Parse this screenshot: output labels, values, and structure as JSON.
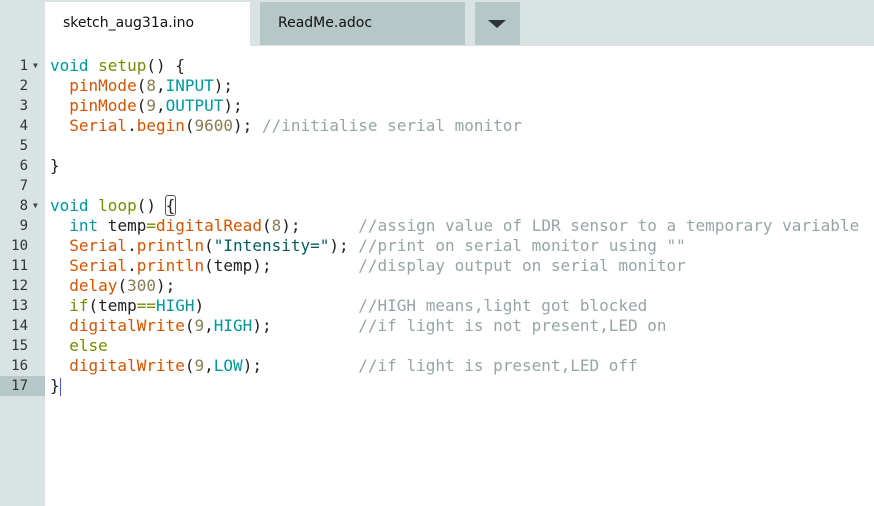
{
  "tabs": [
    {
      "label": "sketch_aug31a.ino",
      "active": true
    },
    {
      "label": "ReadMe.adoc",
      "active": false
    }
  ],
  "tab_menu_icon": "triangle-down-icon",
  "current_line": 17,
  "lines": [
    {
      "n": "1",
      "fold": true,
      "tokens": [
        [
          "kw",
          "void"
        ],
        [
          "pl",
          " "
        ],
        [
          "ctl",
          "setup"
        ],
        [
          "pl",
          "() {"
        ]
      ]
    },
    {
      "n": "2",
      "tokens": [
        [
          "pl",
          "  "
        ],
        [
          "fn",
          "pinMode"
        ],
        [
          "pl",
          "("
        ],
        [
          "num",
          "8"
        ],
        [
          "pl",
          ","
        ],
        [
          "cst",
          "INPUT"
        ],
        [
          "pl",
          ");"
        ]
      ]
    },
    {
      "n": "3",
      "tokens": [
        [
          "pl",
          "  "
        ],
        [
          "fn",
          "pinMode"
        ],
        [
          "pl",
          "("
        ],
        [
          "num",
          "9"
        ],
        [
          "pl",
          ","
        ],
        [
          "cst",
          "OUTPUT"
        ],
        [
          "pl",
          ");"
        ]
      ]
    },
    {
      "n": "4",
      "tokens": [
        [
          "pl",
          "  "
        ],
        [
          "fn",
          "Serial"
        ],
        [
          "pl",
          "."
        ],
        [
          "fn",
          "begin"
        ],
        [
          "pl",
          "("
        ],
        [
          "num",
          "9600"
        ],
        [
          "pl",
          "); "
        ],
        [
          "cmt",
          "//initialise serial monitor"
        ]
      ]
    },
    {
      "n": "5",
      "tokens": []
    },
    {
      "n": "6",
      "tokens": [
        [
          "pl",
          "}"
        ]
      ]
    },
    {
      "n": "7",
      "tokens": []
    },
    {
      "n": "8",
      "fold": true,
      "tokens": [
        [
          "kw",
          "void"
        ],
        [
          "pl",
          " "
        ],
        [
          "ctl",
          "loop"
        ],
        [
          "pl",
          "() "
        ],
        [
          "bm",
          "{"
        ]
      ]
    },
    {
      "n": "9",
      "tokens": [
        [
          "pl",
          "  "
        ],
        [
          "kw",
          "int"
        ],
        [
          "pl",
          " temp"
        ],
        [
          "op",
          "="
        ],
        [
          "fn",
          "digitalRead"
        ],
        [
          "pl",
          "("
        ],
        [
          "num",
          "8"
        ],
        [
          "pl",
          ");      "
        ],
        [
          "cmt",
          "//assign value of LDR sensor to a temporary variable"
        ]
      ]
    },
    {
      "n": "10",
      "tokens": [
        [
          "pl",
          "  "
        ],
        [
          "fn",
          "Serial"
        ],
        [
          "pl",
          "."
        ],
        [
          "fn",
          "println"
        ],
        [
          "pl",
          "("
        ],
        [
          "str",
          "\"Intensity=\""
        ],
        [
          "pl",
          "); "
        ],
        [
          "cmt",
          "//print on serial monitor using \"\""
        ]
      ]
    },
    {
      "n": "11",
      "tokens": [
        [
          "pl",
          "  "
        ],
        [
          "fn",
          "Serial"
        ],
        [
          "pl",
          "."
        ],
        [
          "fn",
          "println"
        ],
        [
          "pl",
          "(temp);         "
        ],
        [
          "cmt",
          "//display output on serial monitor"
        ]
      ]
    },
    {
      "n": "12",
      "tokens": [
        [
          "pl",
          "  "
        ],
        [
          "fn",
          "delay"
        ],
        [
          "pl",
          "("
        ],
        [
          "num",
          "300"
        ],
        [
          "pl",
          ");"
        ]
      ]
    },
    {
      "n": "13",
      "tokens": [
        [
          "pl",
          "  "
        ],
        [
          "ctl",
          "if"
        ],
        [
          "pl",
          "(temp"
        ],
        [
          "op",
          "=="
        ],
        [
          "cst",
          "HIGH"
        ],
        [
          "pl",
          ")                "
        ],
        [
          "cmt",
          "//HIGH means,light got blocked"
        ]
      ]
    },
    {
      "n": "14",
      "tokens": [
        [
          "pl",
          "  "
        ],
        [
          "fn",
          "digitalWrite"
        ],
        [
          "pl",
          "("
        ],
        [
          "num",
          "9"
        ],
        [
          "pl",
          ","
        ],
        [
          "cst",
          "HIGH"
        ],
        [
          "pl",
          ");         "
        ],
        [
          "cmt",
          "//if light is not present,LED on"
        ]
      ]
    },
    {
      "n": "15",
      "tokens": [
        [
          "pl",
          "  "
        ],
        [
          "ctl",
          "else"
        ]
      ]
    },
    {
      "n": "16",
      "tokens": [
        [
          "pl",
          "  "
        ],
        [
          "fn",
          "digitalWrite"
        ],
        [
          "pl",
          "("
        ],
        [
          "num",
          "9"
        ],
        [
          "pl",
          ","
        ],
        [
          "cst",
          "LOW"
        ],
        [
          "pl",
          ");          "
        ],
        [
          "cmt",
          "//if light is present,LED off"
        ]
      ]
    },
    {
      "n": "17",
      "tokens": [
        [
          "pl",
          "}"
        ],
        [
          "caret",
          ""
        ]
      ]
    }
  ]
}
